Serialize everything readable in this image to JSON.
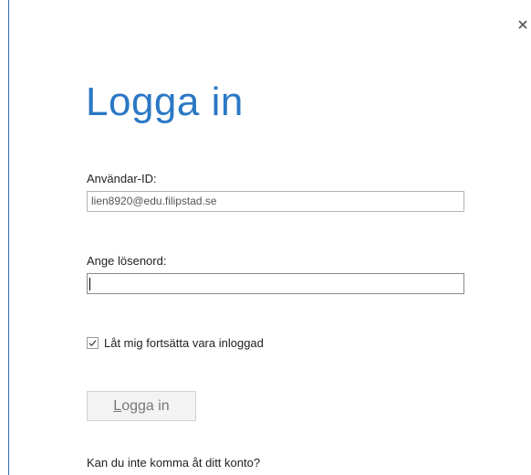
{
  "dialog": {
    "title": "Logga in",
    "close_icon": "close-icon",
    "accent_color": "#2b78c5"
  },
  "user_id": {
    "label": "Användar-ID:",
    "value": "lien8920@edu.filipstad.se"
  },
  "password": {
    "label": "Ange lösenord:",
    "value": ""
  },
  "remember": {
    "label": "Låt mig fortsätta vara inloggad",
    "checked": true,
    "icon": "checkmark-icon"
  },
  "signin_button": {
    "mnemonic": "L",
    "rest": "ogga in"
  },
  "help_link": {
    "text": "Kan du inte komma åt ditt konto?"
  }
}
